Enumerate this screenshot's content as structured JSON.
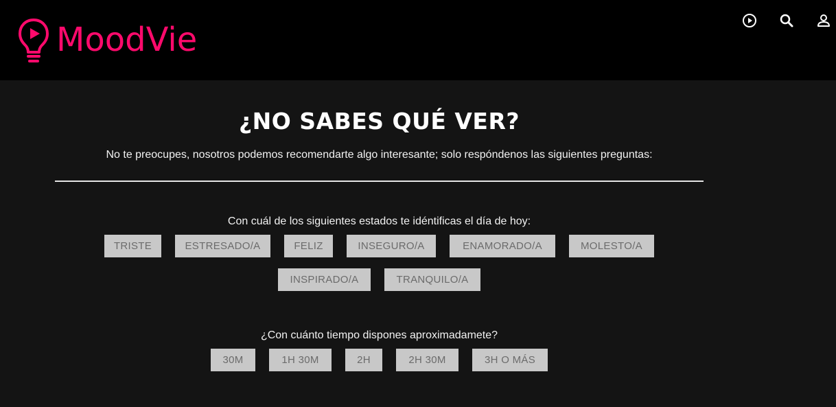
{
  "header": {
    "brand": "MoodVie",
    "brand_color": "#ff0a6c",
    "icons": [
      "play-circle-icon",
      "search-icon",
      "user-icon"
    ]
  },
  "main": {
    "title": "¿NO SABES QUÉ VER?",
    "subtitle": "No te preocupes, nosotros podemos recomendarte algo interesante; solo respóndenos las siguientes preguntas:",
    "question_mood": "Con cuál de los siguientes estados te idéntificas el día de hoy:",
    "moods": [
      "TRISTE",
      "ESTRESADO/A",
      "FELIZ",
      "INSEGURO/A",
      "ENAMORADO/A",
      "MOLESTO/A",
      "INSPIRADO/A",
      "TRANQUILO/A"
    ],
    "question_time": "¿Con cuánto tiempo dispones aproximadamete?",
    "times": [
      "30M",
      "1H 30M",
      "2H",
      "2H 30M",
      "3H O MÁS"
    ]
  }
}
